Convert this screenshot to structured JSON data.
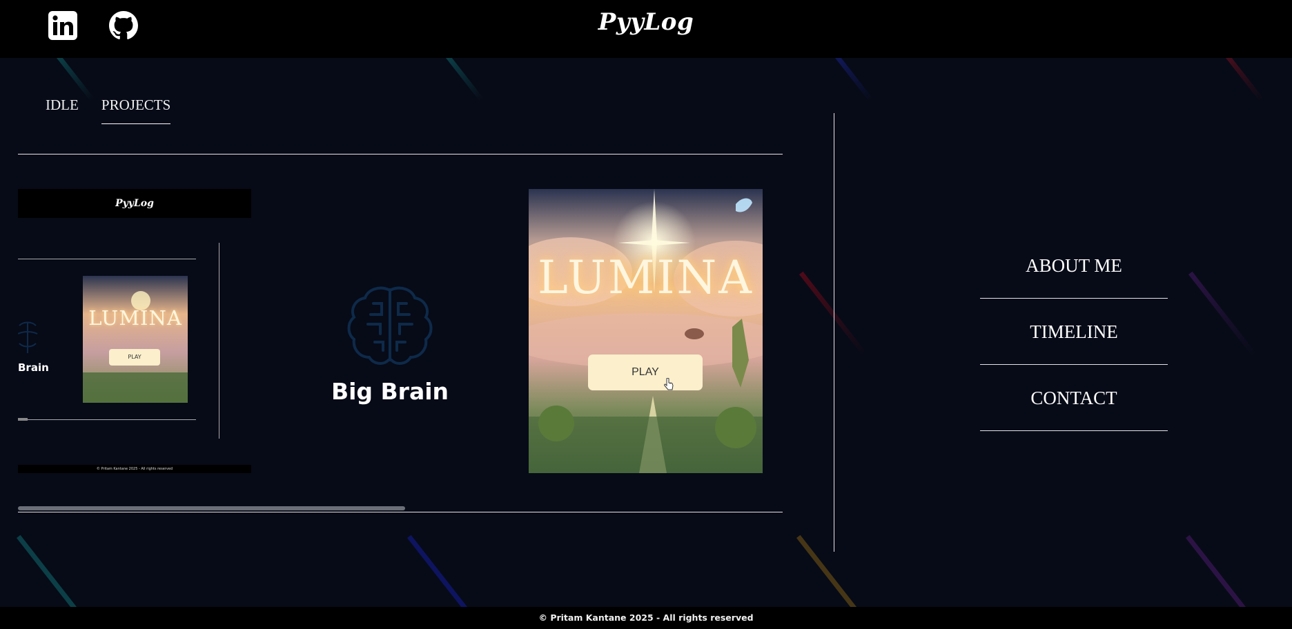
{
  "header": {
    "brand": "PyyLog",
    "social": [
      {
        "name": "linkedin-icon"
      },
      {
        "name": "github-icon"
      }
    ]
  },
  "tabs": [
    {
      "label": "IDLE",
      "active": false
    },
    {
      "label": "PROJECTS",
      "active": true
    }
  ],
  "projects": {
    "preview": {
      "brand": "PyyLog",
      "lumina_title": "LUMINA",
      "play_label": "PLAY",
      "brain_label": "Brain",
      "footer": "© Pritam Kantane 2025 - All rights reserved"
    },
    "big_brain": {
      "title": "Big Brain",
      "icon": "brain-icon"
    },
    "lumina": {
      "title": "LUMINA",
      "play_label": "PLAY"
    }
  },
  "sidebar": {
    "links": [
      {
        "label": "ABOUT ME"
      },
      {
        "label": "TIMELINE"
      },
      {
        "label": "CONTACT"
      }
    ]
  },
  "footer": {
    "text": "© Pritam Kantane 2025 - All rights reserved"
  }
}
